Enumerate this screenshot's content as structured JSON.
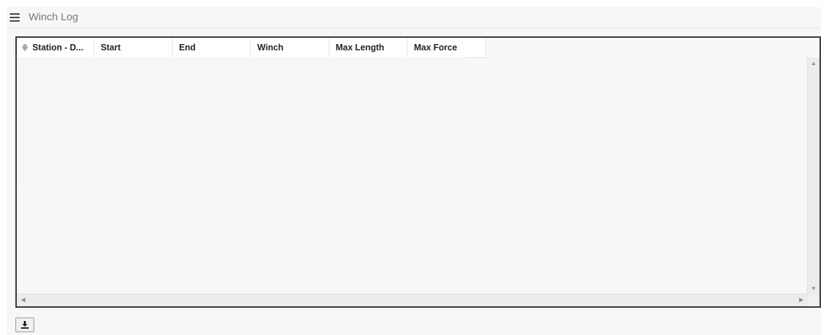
{
  "header": {
    "title": "Winch Log",
    "menu_icon": "hamburger-menu-icon"
  },
  "grid": {
    "columns": [
      {
        "label": "Station - D...",
        "sorted": "descending"
      },
      {
        "label": "Start"
      },
      {
        "label": "End"
      },
      {
        "label": "Winch"
      },
      {
        "label": "Max Length"
      },
      {
        "label": "Max Force"
      }
    ],
    "rows": []
  },
  "toolbar": {
    "download_icon": "download-icon"
  }
}
